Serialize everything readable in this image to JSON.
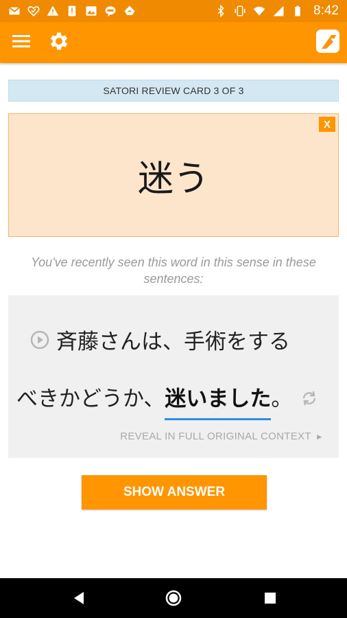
{
  "status_bar": {
    "time": "8:42",
    "left_icons": [
      "gmail-icon",
      "heart-icon",
      "warning-icon",
      "sim-icon",
      "image-icon",
      "line-chat-icon",
      "feedly-icon"
    ],
    "right_icons": [
      "bluetooth-icon",
      "vibrate-icon",
      "wifi-icon",
      "signal-icon",
      "battery-icon"
    ]
  },
  "toolbar": {
    "background": "#ff9500",
    "icons": [
      "menu-icon",
      "settings-icon",
      "satori-logo-icon"
    ]
  },
  "review_header": {
    "label": "SATORI REVIEW CARD 3 OF 3"
  },
  "card": {
    "word": "迷う",
    "close_label": "X"
  },
  "hint": {
    "text": "You've recently seen this word in this sense in these sentences:"
  },
  "sentence": {
    "line1": "斉藤さんは、手術をする",
    "line2_prefix": "べきかどうか、",
    "target": "迷いました",
    "line2_suffix": "。",
    "reveal_label": "REVEAL IN FULL ORIGINAL CONTEXT",
    "reveal_arrow": "►"
  },
  "actions": {
    "show_answer": "SHOW ANSWER"
  },
  "colors": {
    "accent": "#ff9500",
    "card_bg": "#fde5cb",
    "header_bg": "#d3e8f2",
    "underline": "#2f8ae6"
  }
}
